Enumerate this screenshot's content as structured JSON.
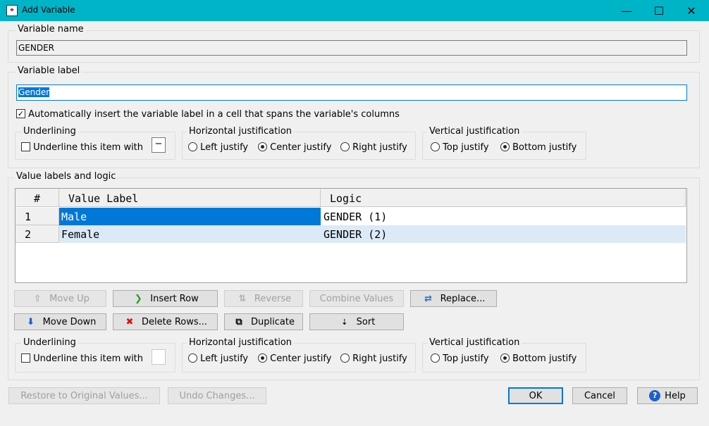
{
  "window": {
    "title": "Add Variable",
    "icon_label": "⌖",
    "controls": {
      "minimize": "—",
      "maximize": "☐",
      "close": "✕"
    }
  },
  "variable_name": {
    "label": "Variable name",
    "value": "GENDER"
  },
  "variable_label": {
    "label": "Variable label",
    "value": "Gender",
    "auto_insert_label": "Automatically insert the variable label in a cell that spans the variable's columns",
    "auto_insert_checked": true
  },
  "top_underlining": {
    "label": "Underlining",
    "checkbox_label": "Underline this item with",
    "char": "−"
  },
  "top_hjust": {
    "label": "Horizontal justification",
    "options": [
      "Left justify",
      "Center justify",
      "Right justify"
    ],
    "selected": "Center justify"
  },
  "top_vjust": {
    "label": "Vertical justification",
    "options": [
      "Top justify",
      "Bottom justify"
    ],
    "selected": "Bottom justify"
  },
  "value_labels": {
    "label": "Value labels and logic",
    "columns": [
      "#",
      "Value Label",
      "Logic"
    ],
    "rows": [
      {
        "num": "1",
        "value_label": "Male",
        "logic": "GENDER (1)"
      },
      {
        "num": "2",
        "value_label": "Female",
        "logic": "GENDER (2)"
      }
    ]
  },
  "row_buttons": {
    "move_up": "Move Up",
    "insert_row": "Insert Row",
    "reverse": "Reverse",
    "combine_values": "Combine Values",
    "replace": "Replace...",
    "move_down": "Move Down",
    "delete_rows": "Delete Rows...",
    "duplicate": "Duplicate",
    "sort": "Sort"
  },
  "bottom_underlining": {
    "label": "Underlining",
    "checkbox_label": "Underline this item with",
    "char": ""
  },
  "bottom_hjust": {
    "label": "Horizontal justification",
    "options": [
      "Left justify",
      "Center justify",
      "Right justify"
    ],
    "selected": "Center justify"
  },
  "bottom_vjust": {
    "label": "Vertical justification",
    "options": [
      "Top justify",
      "Bottom justify"
    ],
    "selected": "Bottom justify"
  },
  "footer": {
    "restore": "Restore to Original Values...",
    "undo": "Undo Changes...",
    "ok": "OK",
    "cancel": "Cancel",
    "help": "Help"
  },
  "colors": {
    "titlebar": "#00b4c8",
    "selection": "#0078d7",
    "row_alt": "#dce9f7"
  }
}
